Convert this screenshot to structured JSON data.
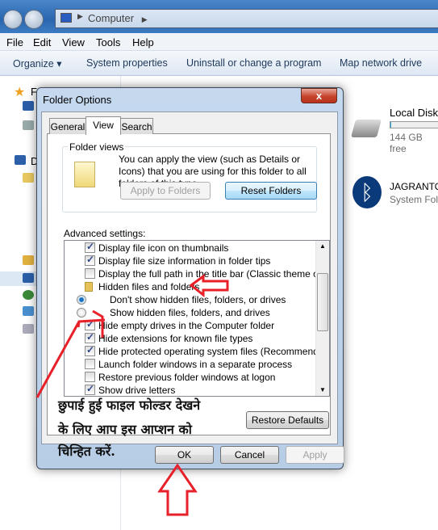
{
  "explorer": {
    "address": "Computer",
    "menu": [
      "File",
      "Edit",
      "View",
      "Tools",
      "Help"
    ],
    "toolbar": {
      "organize": "Organize ▾",
      "system_properties": "System properties",
      "uninstall": "Uninstall or change a program",
      "map_drive": "Map network drive"
    },
    "nav_partial": [
      "F",
      "D"
    ],
    "drive": {
      "name": "Local Disk (",
      "free": "144 GB free",
      "fill_percent": 2
    },
    "bluetooth": {
      "name": "JAGRANTO",
      "type": "System Fold"
    }
  },
  "dialog": {
    "title": "Folder Options",
    "close": "x",
    "tabs": [
      "General",
      "View",
      "Search"
    ],
    "active_tab": "View",
    "folder_views": {
      "legend": "Folder views",
      "description": "You can apply the view (such as Details or Icons) that you are using for this folder to all folders of this type.",
      "apply": "Apply to Folders",
      "reset": "Reset Folders"
    },
    "advanced_label": "Advanced settings:",
    "settings": [
      {
        "type": "checkbox",
        "checked": true,
        "label": "Display file icon on thumbnails"
      },
      {
        "type": "checkbox",
        "checked": true,
        "label": "Display file size information in folder tips"
      },
      {
        "type": "checkbox",
        "checked": false,
        "label": "Display the full path in the title bar (Classic theme only)"
      },
      {
        "type": "folder",
        "label": "Hidden files and folders"
      },
      {
        "type": "radio",
        "checked": true,
        "label": "Don't show hidden files, folders, or drives"
      },
      {
        "type": "radio",
        "checked": false,
        "label": "Show hidden files, folders, and drives"
      },
      {
        "type": "checkbox",
        "checked": true,
        "label": "Hide empty drives in the Computer folder"
      },
      {
        "type": "checkbox",
        "checked": true,
        "label": "Hide extensions for known file types"
      },
      {
        "type": "checkbox",
        "checked": true,
        "label": "Hide protected operating system files (Recommended)"
      },
      {
        "type": "checkbox",
        "checked": false,
        "label": "Launch folder windows in a separate process"
      },
      {
        "type": "checkbox",
        "checked": false,
        "label": "Restore previous folder windows at logon"
      },
      {
        "type": "checkbox",
        "checked": true,
        "label": "Show drive letters"
      }
    ],
    "restore_defaults": "Restore Defaults",
    "ok": "OK",
    "cancel": "Cancel",
    "apply": "Apply"
  },
  "annotation": {
    "lines": [
      "छुपाई हुई फाइल फोल्डर देखने",
      "के लिए आप इस आप्शन को",
      "चिन्हित करें."
    ],
    "arrow_color": "#e8202a"
  }
}
